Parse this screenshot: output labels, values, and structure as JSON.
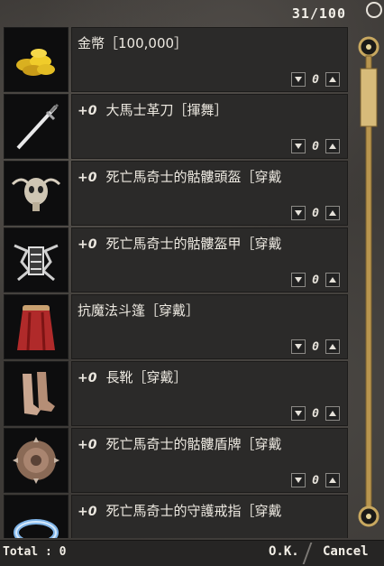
{
  "header": {
    "item_count": "31/100"
  },
  "items": [
    {
      "enhance": "",
      "name": "金幣［100,000］",
      "quantity": "0",
      "icon": "gold-coins-icon"
    },
    {
      "enhance": "+0",
      "name": "大馬士革刀［揮舞］",
      "quantity": "0",
      "icon": "damascus-sword-icon"
    },
    {
      "enhance": "+0",
      "name": "死亡馬奇士的骷髏頭盔［穿戴",
      "quantity": "0",
      "icon": "skull-helmet-icon"
    },
    {
      "enhance": "+0",
      "name": "死亡馬奇士的骷髏盔甲［穿戴",
      "quantity": "0",
      "icon": "skull-armor-icon"
    },
    {
      "enhance": "",
      "name": "抗魔法斗篷［穿戴］",
      "quantity": "0",
      "icon": "red-cloak-icon"
    },
    {
      "enhance": "+0",
      "name": "長靴［穿戴］",
      "quantity": "0",
      "icon": "boots-icon"
    },
    {
      "enhance": "+0",
      "name": "死亡馬奇士的骷髏盾牌［穿戴",
      "quantity": "0",
      "icon": "skull-shield-icon"
    },
    {
      "enhance": "+0",
      "name": "死亡馬奇士的守護戒指［穿戴",
      "quantity": "0",
      "icon": "ring-icon"
    }
  ],
  "footer": {
    "total_label": "Total",
    "total_value": ": 0",
    "ok_label": "O.K.",
    "cancel_label": "Cancel"
  },
  "colors": {
    "panel": "#2b2a29",
    "text": "#ece8e0",
    "scrollbar_gold": "#c8a860"
  }
}
